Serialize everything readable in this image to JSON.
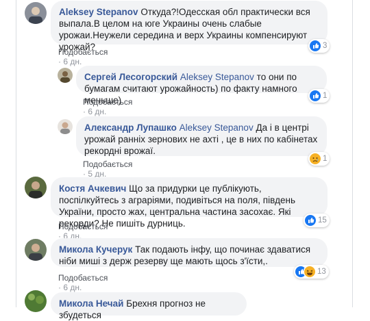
{
  "comments": [
    {
      "author": "Aleksey Stepanov",
      "mention": "",
      "text": "Откуда?!Одесская обл практически вся выпала.В целом на юге Украины очень слабые урожаи.Неужели середина и верх Украины компенсируют урожай?",
      "like_label": "Подобається",
      "time": "6 дн.",
      "reactions": [
        "like"
      ],
      "reaction_count": "3"
    },
    {
      "author": "Сергей Лесогорский",
      "mention": "Aleksey Stepanov",
      "text": "то они по бумагам считают урожайность) по факту намного меньше)",
      "like_label": "Подобається",
      "time": "6 дн.",
      "reactions": [
        "like"
      ],
      "reaction_count": "1"
    },
    {
      "author": "Александр Лупашко",
      "mention": "Aleksey Stepanov",
      "text": "Да і в центрі урожай ранніх зернових не ахті , це в них по кабінетах рекордні врожаї.",
      "like_label": "Подобається",
      "time": "5 дн.",
      "reactions": [
        "sad"
      ],
      "reaction_count": "1"
    },
    {
      "author": "Костя Ачкевич",
      "mention": "",
      "text": "Що за придурки це публікують, поспілкуйтесь з аграріями, подивіться на поля, південь України, просто жах, центральна частина засохає. Які рекорди? Не пишіть дурниць.",
      "like_label": "Подобається",
      "time": "6 дн.",
      "reactions": [
        "like"
      ],
      "reaction_count": "15"
    },
    {
      "author": "Микола Кучерук",
      "mention": "",
      "text": "Так подають інфу, що починає здаватися ніби миші з держ резерву ще мають щось з'їсти,.",
      "like_label": "Подобається",
      "time": "6 дн.",
      "reactions": [
        "like",
        "haha"
      ],
      "reaction_count": "13"
    },
    {
      "author": "Микола Нечай",
      "mention": "",
      "text": "Брехня прогноз не збудеться",
      "like_label": "",
      "time": "",
      "reactions": [],
      "reaction_count": ""
    }
  ],
  "meta_separator": "·",
  "colors": {
    "link": "#385898",
    "bubble": "#f2f3f5",
    "meta": "#90949c",
    "like_blue": "#1877f2",
    "reaction_yellow": "#f7b125"
  }
}
